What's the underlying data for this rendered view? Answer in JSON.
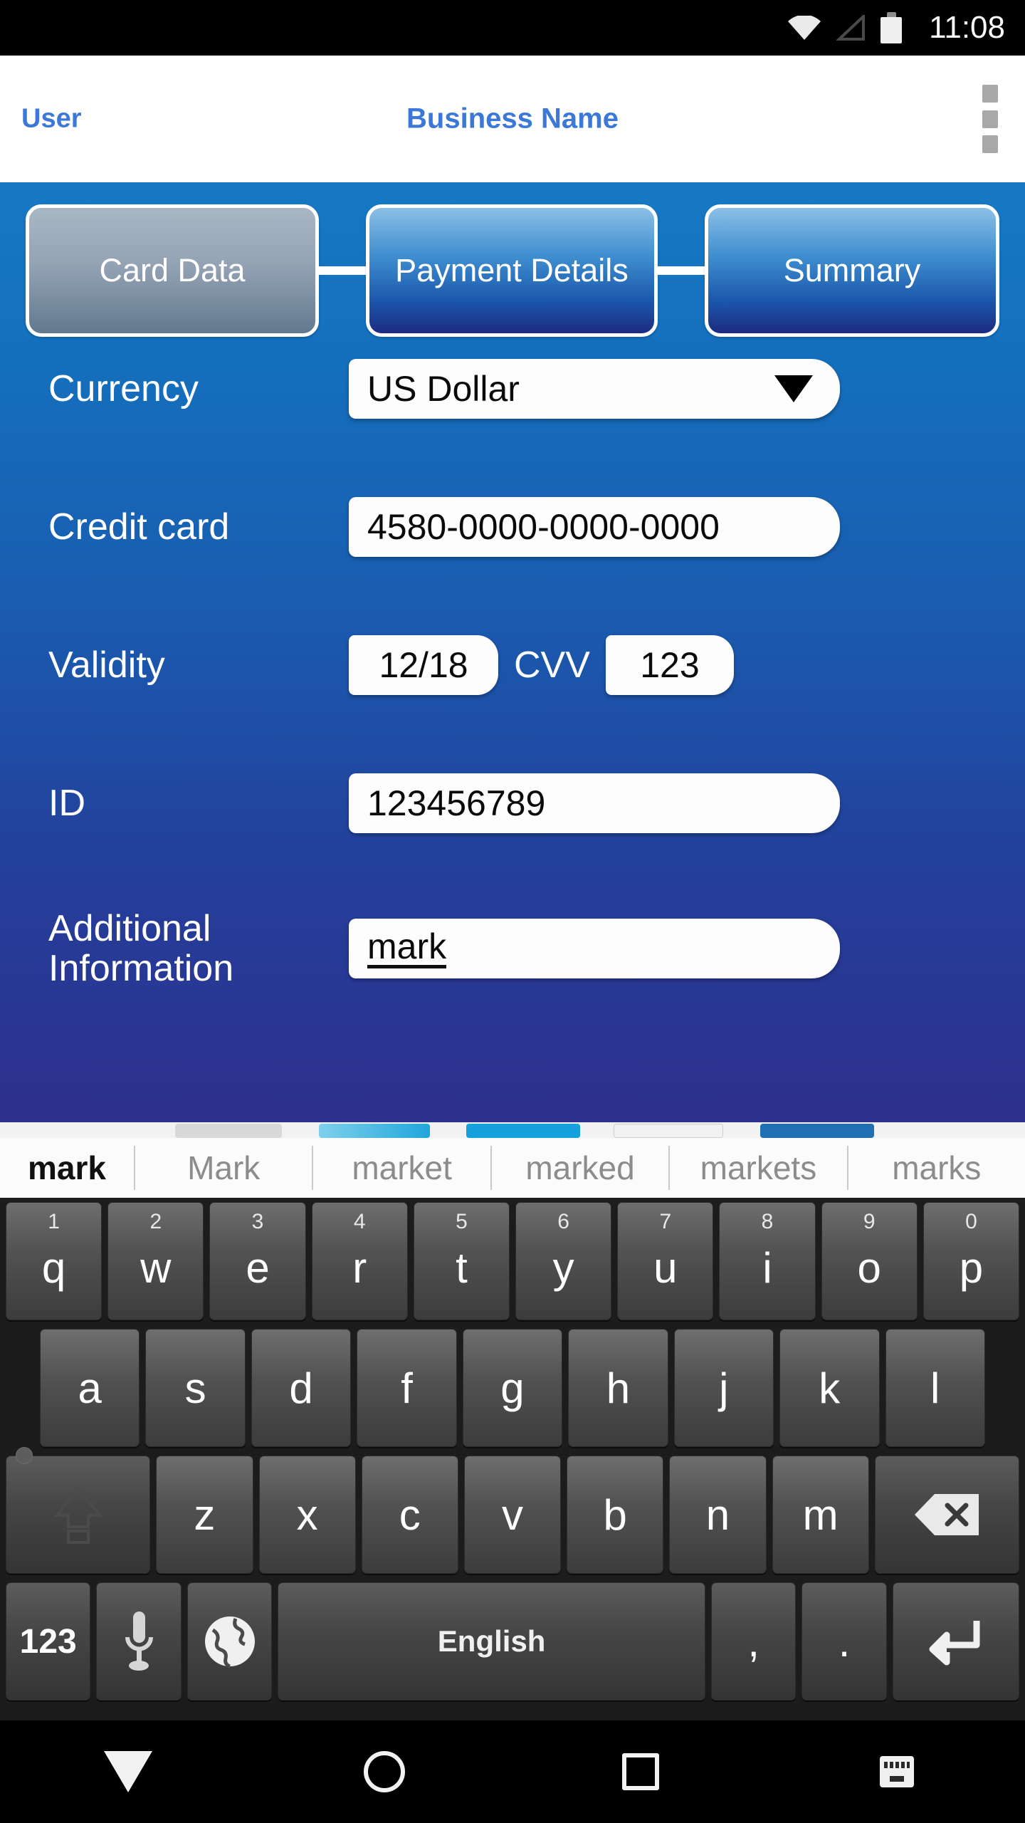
{
  "statusbar": {
    "time": "11:08",
    "icons": [
      "wifi-icon",
      "cell-signal-icon",
      "battery-icon"
    ]
  },
  "appbar": {
    "user_label": "User",
    "title": "Business Name",
    "overflow_icon": "overflow-menu-icon"
  },
  "steps": [
    {
      "label": "Card Data",
      "state": "inactive"
    },
    {
      "label": "Payment Details",
      "state": "active"
    },
    {
      "label": "Summary",
      "state": "active"
    }
  ],
  "form": {
    "currency": {
      "label": "Currency",
      "value": "US Dollar",
      "caret_icon": "chevron-down-icon"
    },
    "credit_card": {
      "label": "Credit card",
      "value": "4580-0000-0000-0000"
    },
    "validity": {
      "label": "Validity",
      "value": "12/18"
    },
    "cvv": {
      "label": "CVV",
      "value": "123"
    },
    "id": {
      "label": "ID",
      "value": "123456789"
    },
    "additional": {
      "label": "Additional Information",
      "value": "mark"
    }
  },
  "keyboard": {
    "suggestions": [
      "mark",
      "Mark",
      "market",
      "marked",
      "markets",
      "marks"
    ],
    "row1": [
      {
        "key": "q",
        "num": "1"
      },
      {
        "key": "w",
        "num": "2"
      },
      {
        "key": "e",
        "num": "3"
      },
      {
        "key": "r",
        "num": "4"
      },
      {
        "key": "t",
        "num": "5"
      },
      {
        "key": "y",
        "num": "6"
      },
      {
        "key": "u",
        "num": "7"
      },
      {
        "key": "i",
        "num": "8"
      },
      {
        "key": "o",
        "num": "9"
      },
      {
        "key": "p",
        "num": "0"
      }
    ],
    "row2": [
      "a",
      "s",
      "d",
      "f",
      "g",
      "h",
      "j",
      "k",
      "l"
    ],
    "row3_letters": [
      "z",
      "x",
      "c",
      "v",
      "b",
      "n",
      "m"
    ],
    "shift_icon": "shift-icon",
    "backspace_icon": "backspace-icon",
    "num_key": "123",
    "mic_icon": "microphone-icon",
    "globe_icon": "globe-language-icon",
    "space_label": "English",
    "comma": ",",
    "period": ".",
    "enter_icon": "enter-key-icon"
  },
  "navbar": {
    "back_icon": "nav-back-icon",
    "home_icon": "nav-home-icon",
    "recents_icon": "nav-recents-icon",
    "keyboard_icon": "nav-keyboard-icon"
  },
  "colors": {
    "accent_blue": "#3b78d8",
    "bg_top": "#1678c4",
    "bg_bottom": "#2e2f8e",
    "step_active_top": "#8cc0e6",
    "step_active_bottom": "#1d2b80",
    "step_inactive_top": "#a9b6c4",
    "step_inactive_bottom": "#62798f"
  }
}
